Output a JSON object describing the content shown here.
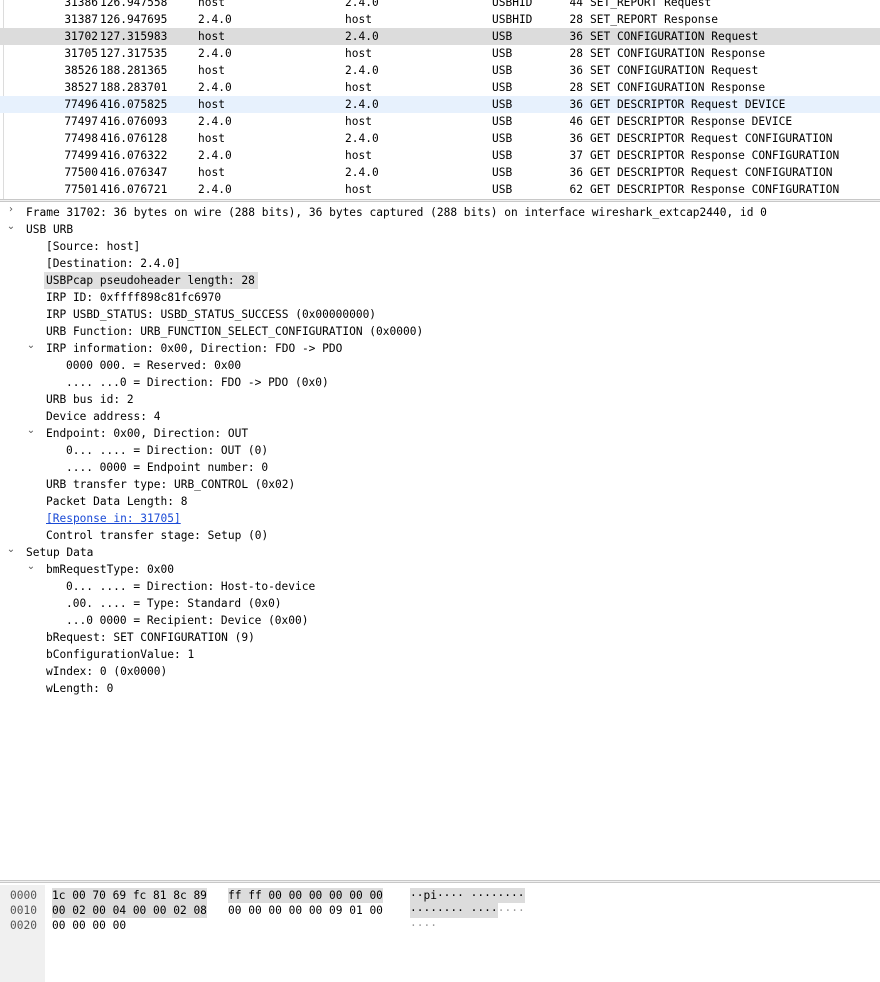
{
  "packets": [
    {
      "no": "31386",
      "time": "126.947558",
      "src": "host",
      "dst": "2.4.0",
      "proto": "USBHID",
      "len": "44",
      "info": "SET_REPORT Request",
      "state": ""
    },
    {
      "no": "31387",
      "time": "126.947695",
      "src": "2.4.0",
      "dst": "host",
      "proto": "USBHID",
      "len": "28",
      "info": "SET_REPORT Response",
      "state": ""
    },
    {
      "no": "31702",
      "time": "127.315983",
      "src": "host",
      "dst": "2.4.0",
      "proto": "USB",
      "len": "36",
      "info": "SET CONFIGURATION Request",
      "state": "selected"
    },
    {
      "no": "31705",
      "time": "127.317535",
      "src": "2.4.0",
      "dst": "host",
      "proto": "USB",
      "len": "28",
      "info": "SET CONFIGURATION Response",
      "state": ""
    },
    {
      "no": "38526",
      "time": "188.281365",
      "src": "host",
      "dst": "2.4.0",
      "proto": "USB",
      "len": "36",
      "info": "SET CONFIGURATION Request",
      "state": ""
    },
    {
      "no": "38527",
      "time": "188.283701",
      "src": "2.4.0",
      "dst": "host",
      "proto": "USB",
      "len": "28",
      "info": "SET CONFIGURATION Response",
      "state": ""
    },
    {
      "no": "77496",
      "time": "416.075825",
      "src": "host",
      "dst": "2.4.0",
      "proto": "USB",
      "len": "36",
      "info": "GET DESCRIPTOR Request DEVICE",
      "state": "related"
    },
    {
      "no": "77497",
      "time": "416.076093",
      "src": "2.4.0",
      "dst": "host",
      "proto": "USB",
      "len": "46",
      "info": "GET DESCRIPTOR Response DEVICE",
      "state": ""
    },
    {
      "no": "77498",
      "time": "416.076128",
      "src": "host",
      "dst": "2.4.0",
      "proto": "USB",
      "len": "36",
      "info": "GET DESCRIPTOR Request CONFIGURATION",
      "state": ""
    },
    {
      "no": "77499",
      "time": "416.076322",
      "src": "2.4.0",
      "dst": "host",
      "proto": "USB",
      "len": "37",
      "info": "GET DESCRIPTOR Response CONFIGURATION",
      "state": ""
    },
    {
      "no": "77500",
      "time": "416.076347",
      "src": "host",
      "dst": "2.4.0",
      "proto": "USB",
      "len": "36",
      "info": "GET DESCRIPTOR Request CONFIGURATION",
      "state": ""
    },
    {
      "no": "77501",
      "time": "416.076721",
      "src": "2.4.0",
      "dst": "host",
      "proto": "USB",
      "len": "62",
      "info": "GET DESCRIPTOR Response CONFIGURATION",
      "state": ""
    }
  ],
  "details": [
    {
      "level": 0,
      "arrow": "collapsed",
      "text": "Frame 31702: 36 bytes on wire (288 bits), 36 bytes captured (288 bits) on interface wireshark_extcap2440, id 0"
    },
    {
      "level": 0,
      "arrow": "expanded",
      "text": "USB URB"
    },
    {
      "level": 1,
      "text": "[Source: host]"
    },
    {
      "level": 1,
      "text": "[Destination: 2.4.0]"
    },
    {
      "level": 1,
      "text": "USBPcap pseudoheader length: 28",
      "highlight": true
    },
    {
      "level": 1,
      "text": "IRP ID: 0xffff898c81fc6970"
    },
    {
      "level": 1,
      "text": "IRP USBD_STATUS: USBD_STATUS_SUCCESS (0x00000000)"
    },
    {
      "level": 1,
      "text": "URB Function: URB_FUNCTION_SELECT_CONFIGURATION (0x0000)"
    },
    {
      "level": 1,
      "arrow": "expanded",
      "text": "IRP information: 0x00, Direction: FDO -> PDO"
    },
    {
      "level": 2,
      "text": "0000 000. = Reserved: 0x00"
    },
    {
      "level": 2,
      "text": ".... ...0 = Direction: FDO -> PDO (0x0)"
    },
    {
      "level": 1,
      "text": "URB bus id: 2"
    },
    {
      "level": 1,
      "text": "Device address: 4"
    },
    {
      "level": 1,
      "arrow": "expanded",
      "text": "Endpoint: 0x00, Direction: OUT"
    },
    {
      "level": 2,
      "text": "0... .... = Direction: OUT (0)"
    },
    {
      "level": 2,
      "text": ".... 0000 = Endpoint number: 0"
    },
    {
      "level": 1,
      "text": "URB transfer type: URB_CONTROL (0x02)"
    },
    {
      "level": 1,
      "text": "Packet Data Length: 8"
    },
    {
      "level": 1,
      "text": "[Response in: 31705]",
      "link": true
    },
    {
      "level": 1,
      "text": "Control transfer stage: Setup (0)"
    },
    {
      "level": 0,
      "arrow": "expanded",
      "text": "Setup Data"
    },
    {
      "level": 1,
      "arrow": "expanded",
      "text": "bmRequestType: 0x00"
    },
    {
      "level": 2,
      "text": "0... .... = Direction: Host-to-device"
    },
    {
      "level": 2,
      "text": ".00. .... = Type: Standard (0x0)"
    },
    {
      "level": 2,
      "text": "...0 0000 = Recipient: Device (0x00)"
    },
    {
      "level": 1,
      "text": "bRequest: SET CONFIGURATION (9)"
    },
    {
      "level": 1,
      "text": "bConfigurationValue: 1"
    },
    {
      "level": 1,
      "text": "wIndex: 0 (0x0000)"
    },
    {
      "level": 1,
      "text": "wLength: 0"
    }
  ],
  "bytes": [
    {
      "offset": "0000",
      "hex1": "1c 00 70 69 fc 81 8c 89",
      "hex2": "ff ff 00 00 00 00 00 00",
      "ascii": "··pi···· ········",
      "sel1": [
        0,
        23
      ],
      "sel2": [
        0,
        23
      ],
      "selascii": [
        0,
        17
      ]
    },
    {
      "offset": "0010",
      "hex1": "00 02 00 04 00 00 02 08",
      "hex2": "00 00 00 00 00 09 01 00",
      "ascii": "········ ····",
      "asciidim": "····",
      "sel1": [
        0,
        23
      ],
      "sel2": [
        0,
        0
      ],
      "selascii": [
        0,
        13
      ]
    },
    {
      "offset": "0020",
      "hex1": "00 00 00 00",
      "hex2": "",
      "ascii": "",
      "asciidim": "····",
      "sel1": [
        0,
        0
      ],
      "sel2": [
        0,
        0
      ],
      "selascii": [
        0,
        0
      ]
    }
  ]
}
